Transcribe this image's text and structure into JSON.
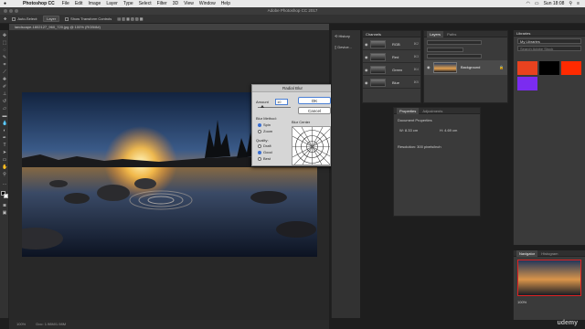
{
  "menubar": {
    "app": "Photoshop CC",
    "items": [
      "File",
      "Edit",
      "Image",
      "Layer",
      "Type",
      "Select",
      "Filter",
      "3D",
      "View",
      "Window",
      "Help"
    ],
    "clock": "Sun 18:08"
  },
  "window": {
    "title": "Adobe Photoshop CC 2017"
  },
  "options": {
    "auto_select": "Auto-Select:",
    "layer": "Layer",
    "show_transform": "Show Transform Controls"
  },
  "document": {
    "tab": "landscape-1802127_960_720.jpg @ 100% (RGB/8#)",
    "status": "100%",
    "doc_info": "Doc: 1.98M/1.98M"
  },
  "dialog": {
    "title": "Radial Blur",
    "amount_label": "Amount",
    "amount_value": "10",
    "ok": "OK",
    "cancel": "Cancel",
    "blur_method_label": "Blur Method:",
    "methods": [
      "Spin",
      "Zoom"
    ],
    "selected_method": "Spin",
    "quality_label": "Quality:",
    "qualities": [
      "Draft",
      "Good",
      "Best"
    ],
    "selected_quality": "Good",
    "blur_center_label": "Blur Center"
  },
  "strip": {
    "items": [
      "History",
      "Device..."
    ]
  },
  "channels": {
    "title": "Channels",
    "rows": [
      {
        "name": "RGB",
        "shortcut": "⌘2"
      },
      {
        "name": "Red",
        "shortcut": "⌘3"
      },
      {
        "name": "Green",
        "shortcut": "⌘4"
      },
      {
        "name": "Blue",
        "shortcut": "⌘5"
      }
    ]
  },
  "layers": {
    "tabs": [
      "Layers",
      "Paths"
    ],
    "layer_name": "Background"
  },
  "properties": {
    "tabs": [
      "Properties",
      "Adjustments"
    ],
    "subtitle": "Document Properties",
    "w": "W: 8.33 cm",
    "h": "H: 4.69 cm",
    "resolution": "Resolution: 300 pixels/inch"
  },
  "libraries": {
    "title": "Libraries",
    "dropdown": "My Libraries",
    "search": "Search Adobe Stock",
    "colors": [
      "#e8421f",
      "#000000",
      "#ff2a00",
      "#7b2cf0"
    ]
  },
  "navigator": {
    "tabs": [
      "Navigator",
      "Histogram"
    ],
    "zoom": "100%"
  },
  "watermark": "udemy"
}
